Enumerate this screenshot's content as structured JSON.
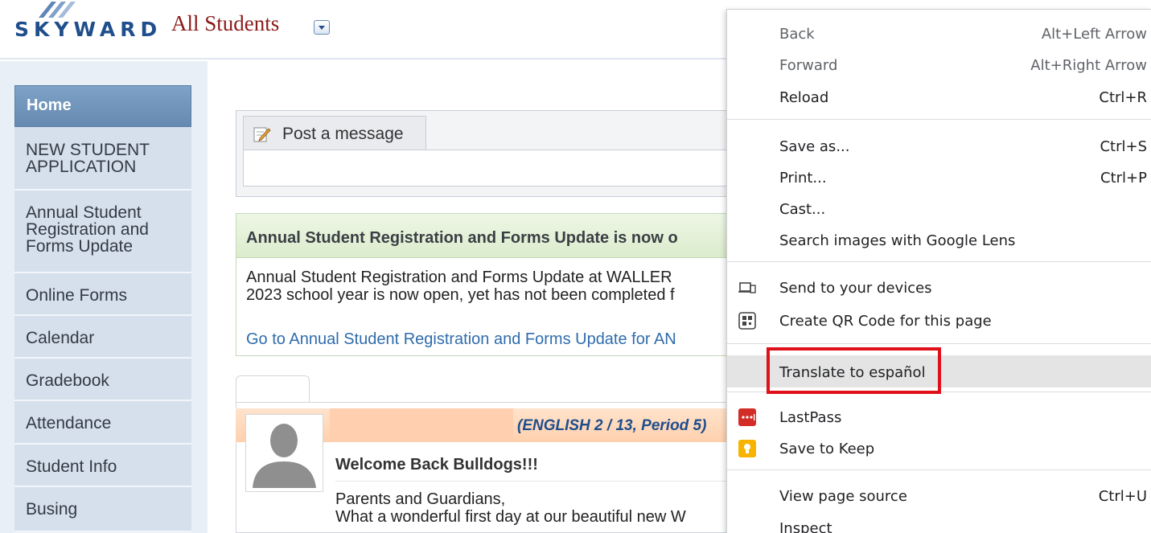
{
  "header": {
    "logo_text": "SKYWARD",
    "scope_title": "All Students"
  },
  "sidebar": {
    "items": [
      {
        "label": "Home"
      },
      {
        "label": "NEW STUDENT APPLICATION"
      },
      {
        "label": "Annual Student Registration and Forms Update"
      },
      {
        "label": "Online Forms"
      },
      {
        "label": "Calendar"
      },
      {
        "label": "Gradebook"
      },
      {
        "label": "Attendance"
      },
      {
        "label": "Student Info"
      },
      {
        "label": "Busing"
      }
    ]
  },
  "post": {
    "tab_label": "Post a message"
  },
  "announcement": {
    "title": "Annual Student Registration and Forms Update is now o",
    "body_line1": "Annual Student Registration and Forms Update at WALLER",
    "body_line2": "2023 school year is now open, yet has not been completed f",
    "link": "Go to Annual Student Registration and Forms Update for AN"
  },
  "message": {
    "sender": "(ENGLISH 2 / 13, Period 5)",
    "title": "Welcome Back Bulldogs!!!",
    "body_line1": "Parents and Guardians,",
    "body_line2": "What a wonderful first day at our beautiful new W"
  },
  "context_menu": {
    "back": {
      "label": "Back",
      "shortcut": "Alt+Left Arrow"
    },
    "forward": {
      "label": "Forward",
      "shortcut": "Alt+Right Arrow"
    },
    "reload": {
      "label": "Reload",
      "shortcut": "Ctrl+R"
    },
    "save_as": {
      "label": "Save as...",
      "shortcut": "Ctrl+S"
    },
    "print": {
      "label": "Print...",
      "shortcut": "Ctrl+P"
    },
    "cast": {
      "label": "Cast..."
    },
    "lens": {
      "label": "Search images with Google Lens"
    },
    "send_devices": {
      "label": "Send to your devices",
      "icon": "devices-icon"
    },
    "qr_code": {
      "label": "Create QR Code for this page",
      "icon": "qr-code-icon"
    },
    "translate": {
      "label": "Translate to español"
    },
    "lastpass": {
      "label": "LastPass",
      "icon": "lastpass-icon"
    },
    "keep": {
      "label": "Save to Keep",
      "icon": "keep-icon"
    },
    "view_source": {
      "label": "View page source",
      "shortcut": "Ctrl+U"
    },
    "inspect": {
      "label": "Inspect"
    }
  },
  "colors": {
    "highlight_box": "#e0101a",
    "brand_blue": "#1f4e8c",
    "scope_title": "#8b1a1a",
    "nav_active": "#6f93bb",
    "link": "#2f6cac"
  }
}
